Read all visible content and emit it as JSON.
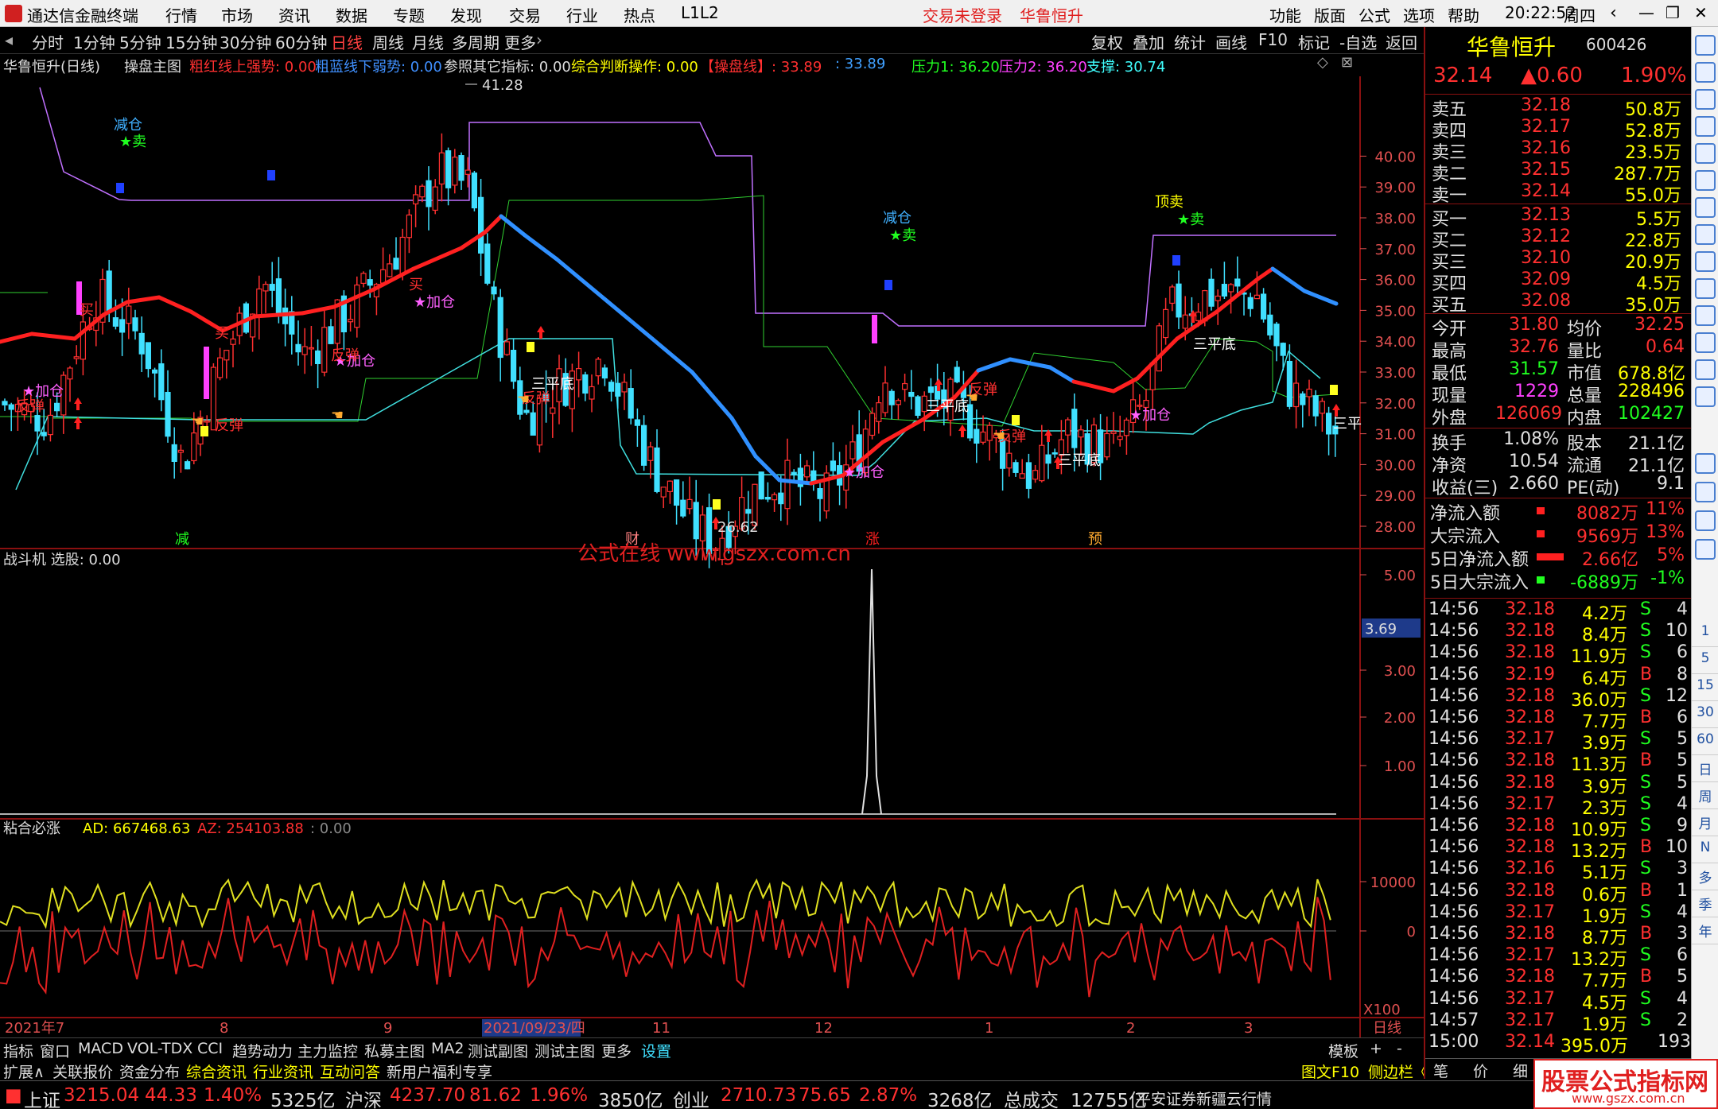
{
  "title_bar": {
    "app": "通达信金融终端",
    "menus": [
      "行情",
      "市场",
      "资讯",
      "数据",
      "专题",
      "发现",
      "交易",
      "行业",
      "热点",
      "L1L2"
    ],
    "login": "交易未登录",
    "stock": "华鲁恒升",
    "right_menus": [
      "功能",
      "版面",
      "公式",
      "选项",
      "帮助"
    ],
    "time": "20:22:52",
    "weekday": "周四"
  },
  "period_bar": {
    "items": [
      "分时",
      "1分钟",
      "5分钟",
      "15分钟",
      "30分钟",
      "60分钟",
      "日线",
      "周线",
      "月线",
      "多周期",
      "更多"
    ],
    "active": "日线",
    "right_items": [
      "复权",
      "叠加",
      "统计",
      "画线",
      "F10",
      "标记",
      "-自选",
      "返回"
    ]
  },
  "main_info": {
    "stock_label": "华鲁恒升(日线)",
    "formula": "操盘主图",
    "p1": "粗红线上强势: 0.00",
    "p2": "粗蓝线下弱势: 0.00",
    "p3": "参照其它指标: 0.00",
    "p4": "综合判断操作: 0.00",
    "p5": "【操盘线】: 33.89",
    "p6": ": 33.89",
    "p7": "压力1: 36.20",
    "p8": "压力2: 36.20",
    "p9": "支撑: 30.74"
  },
  "price_axis": {
    "ticks": [
      "40.00",
      "39.00",
      "38.00",
      "37.00",
      "36.00",
      "35.00",
      "34.00",
      "33.00",
      "32.00",
      "31.00",
      "30.00",
      "29.00",
      "28.00"
    ],
    "high_label": "41.28",
    "low_label": "26.62"
  },
  "annotations": {
    "jiancang": "减仓",
    "mai": "卖",
    "mairu": "买",
    "jiacang": "加仓",
    "fantan": "反弹",
    "sanpingdi": "三平底",
    "dingmai": "顶卖",
    "sanping": "三平"
  },
  "event_labels": [
    "减",
    "财",
    "涨",
    "预"
  ],
  "watermark": "公式在线 www.gszx.com.cn",
  "sub1": {
    "title": "战斗机 选股: 0.00",
    "ticks": [
      "5.00",
      "3.00",
      "2.00",
      "1.00"
    ],
    "marker": "3.69"
  },
  "sub2": {
    "title": "粘合必涨",
    "ad": "AD: 667468.63",
    "az": "AZ: 254103.88",
    "val": ": 0.00",
    "ticks": [
      "10000",
      "0"
    ],
    "unit": "X100"
  },
  "x_axis": {
    "labels": [
      "2021年7",
      "8",
      "9",
      "2021/09/23/四",
      "11",
      "12",
      "1",
      "2",
      "3"
    ],
    "right": "日线"
  },
  "quote": {
    "name": "华鲁恒升",
    "code": "600426",
    "price": "32.14",
    "change": "▲0.60",
    "pct": "1.90%",
    "asks": [
      [
        "卖五",
        "32.18",
        "50.8万"
      ],
      [
        "卖四",
        "32.17",
        "52.8万"
      ],
      [
        "卖三",
        "32.16",
        "23.5万"
      ],
      [
        "卖二",
        "32.15",
        "287.7万"
      ],
      [
        "卖一",
        "32.14",
        "55.0万"
      ]
    ],
    "bids": [
      [
        "买一",
        "32.13",
        "5.5万"
      ],
      [
        "买二",
        "32.12",
        "22.8万"
      ],
      [
        "买三",
        "32.10",
        "20.9万"
      ],
      [
        "买四",
        "32.09",
        "4.5万"
      ],
      [
        "买五",
        "32.08",
        "35.0万"
      ]
    ],
    "stats": [
      [
        "今开",
        "31.80",
        "均价",
        "32.25"
      ],
      [
        "最高",
        "32.76",
        "量比",
        "0.64"
      ],
      [
        "最低",
        "31.57",
        "市值",
        "678.8亿"
      ],
      [
        "现量",
        "1229",
        "总量",
        "228496"
      ],
      [
        "外盘",
        "126069",
        "内盘",
        "102427"
      ]
    ],
    "stats2": [
      [
        "换手",
        "1.08%",
        "股本",
        "21.1亿"
      ],
      [
        "净资",
        "10.54",
        "流通",
        "21.1亿"
      ],
      [
        "收益(三)",
        "2.660",
        "PE(动)",
        "9.1"
      ]
    ],
    "flows": [
      [
        "净流入额",
        "8082万",
        "11%"
      ],
      [
        "大宗流入",
        "9569万",
        "13%"
      ],
      [
        "5日净流入额",
        "2.66亿",
        "5%"
      ],
      [
        "5日大宗流入",
        "-6889万",
        "-1%"
      ]
    ],
    "ticks": [
      [
        "14:56",
        "32.18",
        "4.2万",
        "S",
        "4"
      ],
      [
        "14:56",
        "32.18",
        "8.4万",
        "S",
        "10"
      ],
      [
        "14:56",
        "32.18",
        "11.9万",
        "S",
        "6"
      ],
      [
        "14:56",
        "32.19",
        "6.4万",
        "B",
        "8"
      ],
      [
        "14:56",
        "32.18",
        "36.0万",
        "S",
        "12"
      ],
      [
        "14:56",
        "32.18",
        "7.7万",
        "B",
        "6"
      ],
      [
        "14:56",
        "32.17",
        "3.9万",
        "S",
        "5"
      ],
      [
        "14:56",
        "32.18",
        "11.3万",
        "B",
        "5"
      ],
      [
        "14:56",
        "32.18",
        "3.9万",
        "S",
        "5"
      ],
      [
        "14:56",
        "32.17",
        "2.3万",
        "S",
        "4"
      ],
      [
        "14:56",
        "32.18",
        "10.9万",
        "S",
        "9"
      ],
      [
        "14:56",
        "32.18",
        "13.2万",
        "B",
        "10"
      ],
      [
        "14:56",
        "32.16",
        "5.1万",
        "S",
        "3"
      ],
      [
        "14:56",
        "32.18",
        "0.6万",
        "B",
        "1"
      ],
      [
        "14:56",
        "32.17",
        "1.9万",
        "S",
        "4"
      ],
      [
        "14:56",
        "32.18",
        "8.7万",
        "B",
        "3"
      ],
      [
        "14:56",
        "32.17",
        "13.2万",
        "S",
        "6"
      ],
      [
        "14:56",
        "32.18",
        "7.7万",
        "B",
        "5"
      ],
      [
        "14:56",
        "32.17",
        "4.5万",
        "S",
        "4"
      ],
      [
        "14:57",
        "32.17",
        "1.9万",
        "S",
        "2"
      ],
      [
        "15:00",
        "32.14",
        "395.0万",
        "",
        "193"
      ]
    ]
  },
  "bottom_tabs": [
    "指标",
    "窗口",
    "MACD",
    "VOL-TDX",
    "CCI",
    "趋势动力",
    "主力监控",
    "私募主图",
    "MA2",
    "测试副图",
    "测试主图",
    "更多",
    "设置"
  ],
  "bottom_tabs_right": [
    "模板",
    "+",
    "-"
  ],
  "bottom_tabs2": [
    "扩展∧",
    "关联报价",
    "资金分布",
    "综合资讯",
    "行业资讯",
    "互动问答",
    "新用户福利专享"
  ],
  "bottom_tabs2_right": [
    "图文F10",
    "侧边栏《",
    "笔",
    "价",
    "细",
    "势"
  ],
  "statusbar": {
    "sh": "上证",
    "sh_val": "3215.04",
    "sh_chg": "44.33",
    "sh_pct": "1.40%",
    "sh_amt": "5325亿",
    "sz": "沪深",
    "sz_val": "4237.70",
    "sz_chg": "81.62",
    "sz_pct": "1.96%",
    "sz_amt": "3850亿",
    "cy": "创业",
    "cy_val": "2710.73",
    "cy_chg": "75.65",
    "cy_pct": "2.87%",
    "cy_amt": "3268亿",
    "total": "总成交",
    "total_val": "12755亿",
    "broker": "平安证券新疆云行情",
    "brand": "股票公式指标网",
    "brand_url": "www.gszx.com.cn"
  },
  "right_icon_labels": [
    "1",
    "5",
    "15",
    "30",
    "60",
    "日",
    "周",
    "月",
    "N",
    "多",
    "季",
    "年"
  ]
}
